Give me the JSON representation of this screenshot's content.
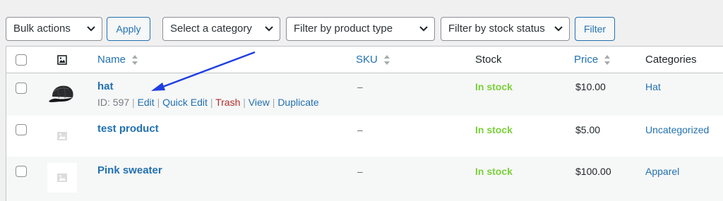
{
  "toolbar": {
    "bulk_actions": "Bulk actions",
    "apply": "Apply",
    "category": "Select a category",
    "product_type": "Filter by product type",
    "stock_status": "Filter by stock status",
    "filter": "Filter"
  },
  "columns": {
    "name": "Name",
    "sku": "SKU",
    "stock": "Stock",
    "price": "Price",
    "categories": "Categories"
  },
  "rows": [
    {
      "name": "hat",
      "sku": "–",
      "stock": "In stock",
      "price": "$10.00",
      "category": "Hat",
      "actions": {
        "id": "ID: 597",
        "sep": "|",
        "edit": "Edit",
        "quick_edit": "Quick Edit",
        "trash": "Trash",
        "view": "View",
        "duplicate": "Duplicate"
      }
    },
    {
      "name": "test product",
      "sku": "–",
      "stock": "In stock",
      "price": "$5.00",
      "category": "Uncategorized"
    },
    {
      "name": "Pink sweater",
      "sku": "–",
      "stock": "In stock",
      "price": "$100.00",
      "category": "Apparel"
    }
  ],
  "colors": {
    "link": "#2271b1",
    "in_stock": "#7ad03a",
    "trash": "#b32d2e",
    "annotation_arrow": "#1f3fe0"
  }
}
